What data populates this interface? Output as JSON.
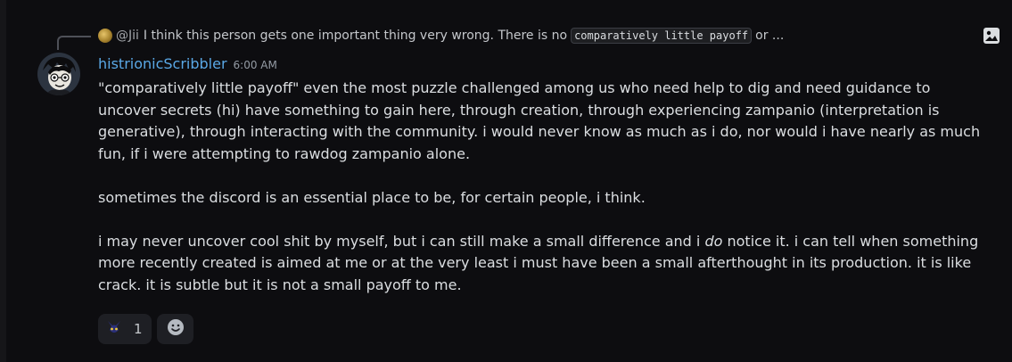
{
  "reply": {
    "author": "@Jii",
    "text_before": "I think this person gets one important thing very wrong. There is no",
    "code": "comparatively little payoff",
    "text_after": "or ..."
  },
  "message": {
    "username": "histrionicScribbler",
    "timestamp": "6:00 AM",
    "paragraphs": [
      "\"comparatively little payoff\" even the most puzzle challenged among us who need help to dig and need guidance to uncover secrets (hi) have something to gain here, through creation, through experiencing zampanio (interpretation is generative), through interacting with the community. i would never know as much as i do, nor would i have nearly as much fun, if i were attempting to rawdog zampanio alone.",
      "sometimes the discord is an essential place to be, for certain people, i think."
    ],
    "last_paragraph": {
      "before": "i may never uncover cool shit by myself, but i can still make a small difference and i ",
      "italic": "do",
      "after": " notice it. i can tell when something more recently created is aimed at me or at the very least i must have been a small afterthought in its production. it is like crack. it is subtle but it is not a small payoff to me."
    }
  },
  "reactions": [
    {
      "emoji_icon": "custom-horned-emoji-icon",
      "count": "1"
    }
  ],
  "icons": {
    "reply_avatar": "reply-author-avatar",
    "corner": "image-icon",
    "add_reaction": "smiley-icon"
  },
  "colors": {
    "background": "#0d0d10",
    "username": "#5aa8e6",
    "text": "#dbdee1",
    "muted": "#949ba4"
  }
}
